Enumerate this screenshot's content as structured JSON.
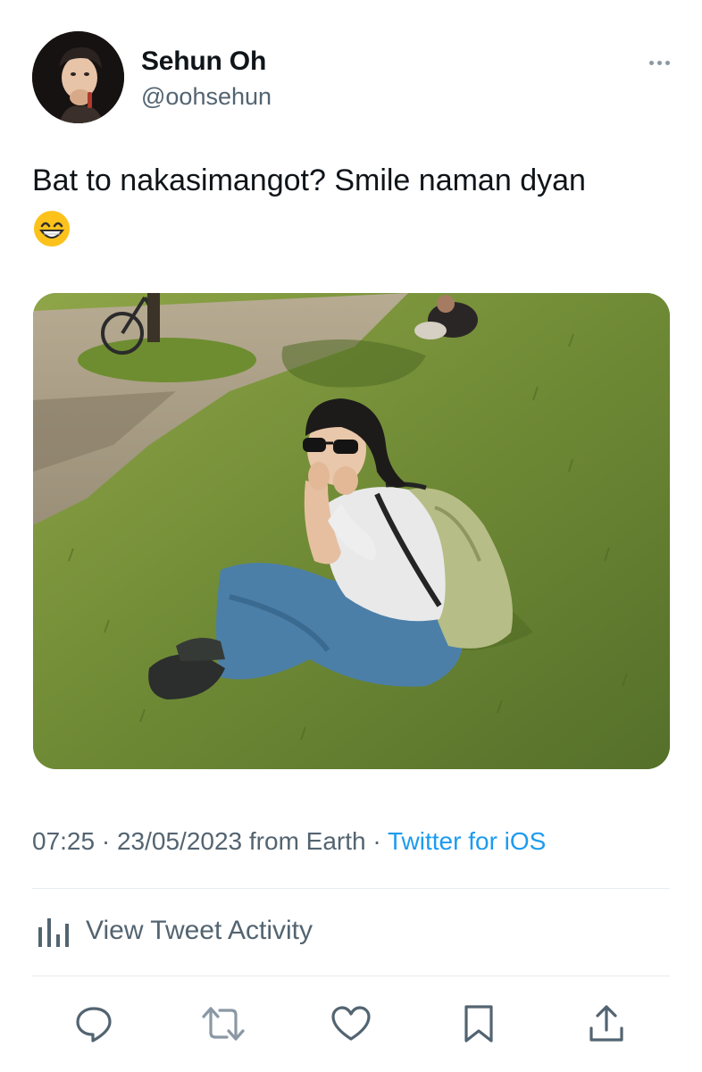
{
  "author": {
    "display_name": "Sehun Oh",
    "handle": "@oohsehun",
    "avatar_icon": "profile-avatar"
  },
  "tweet": {
    "text": "Bat to nakasimangot? Smile naman dyan",
    "emoji": "😁",
    "media_icon": "photo-woman-sitting-on-grass"
  },
  "meta": {
    "time": "07:25",
    "separator": "·",
    "date": "23/05/2023",
    "location": "from Earth",
    "source": "Twitter for iOS"
  },
  "activity": {
    "label": "View Tweet Activity",
    "icon": "bar-chart-icon"
  },
  "actions": [
    {
      "name": "reply",
      "icon": "reply-icon"
    },
    {
      "name": "retweet",
      "icon": "retweet-icon"
    },
    {
      "name": "like",
      "icon": "heart-icon"
    },
    {
      "name": "bookmark",
      "icon": "bookmark-icon"
    },
    {
      "name": "share",
      "icon": "share-icon"
    }
  ],
  "colors": {
    "text": "#0f1419",
    "secondary": "#536471",
    "link": "#1d9bf0",
    "divider": "#e6ecf0"
  }
}
